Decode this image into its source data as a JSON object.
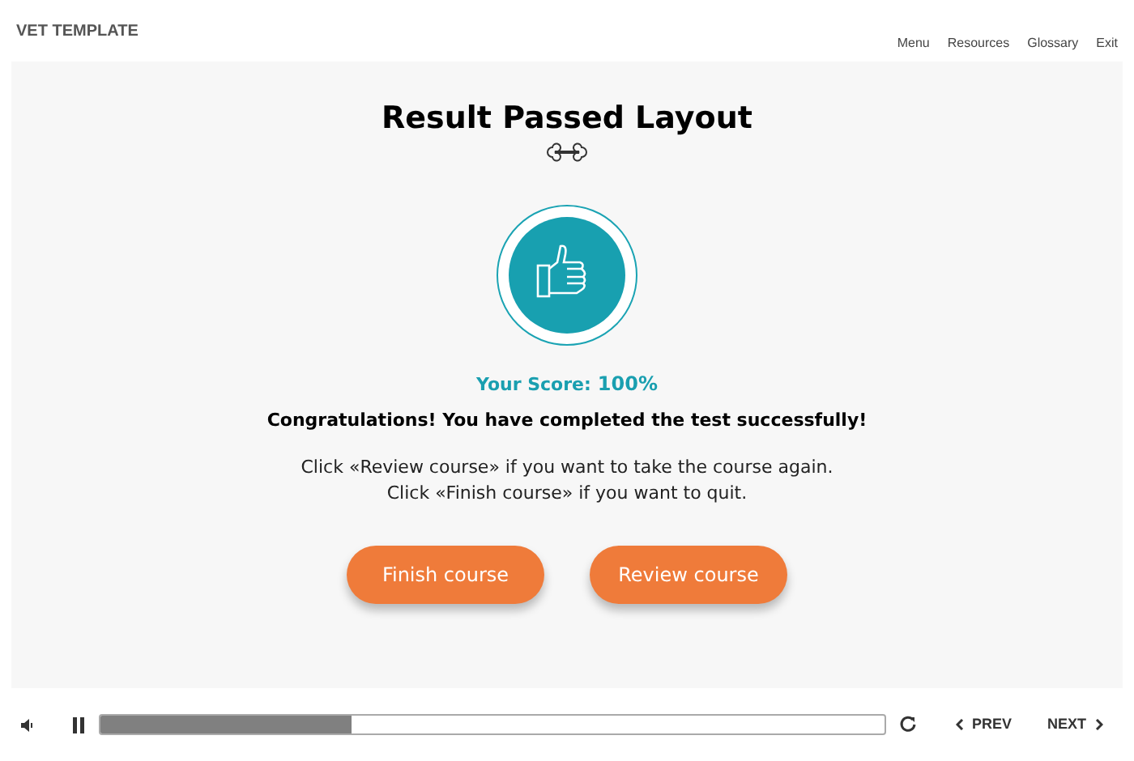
{
  "header": {
    "title": "VET TEMPLATE",
    "nav": [
      "Menu",
      "Resources",
      "Glossary",
      "Exit"
    ]
  },
  "content": {
    "title": "Result Passed Layout",
    "score_label": "Your Score:",
    "score_value": "100%",
    "message": "Congratulations! You have completed the test successfully!",
    "instructions": [
      "Click «Review course» if you want to take the course again.",
      "Click «Finish course» if you want to quit."
    ],
    "buttons": [
      "Finish course",
      "Review course"
    ]
  },
  "player": {
    "progress": {
      "level": 0.32
    },
    "prev": "PREV",
    "next": "NEXT"
  }
}
